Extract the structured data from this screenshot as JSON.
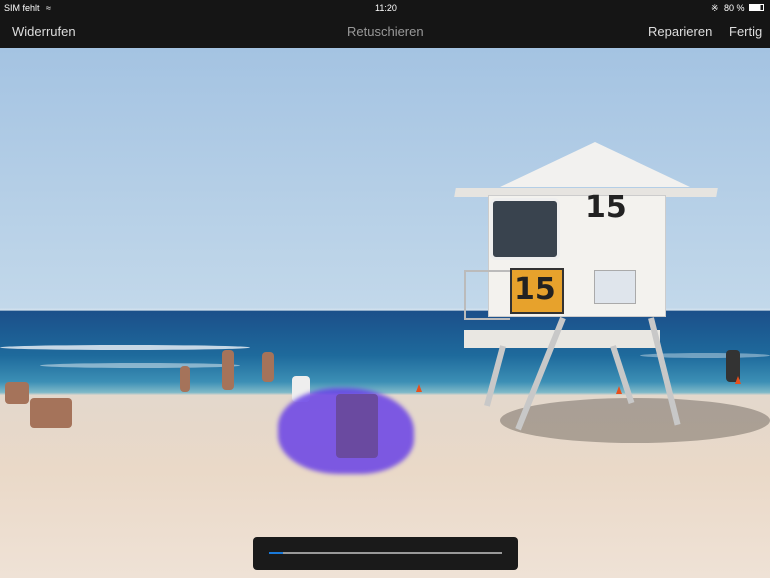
{
  "status_bar": {
    "carrier": "SIM fehlt",
    "wifi_icon": "wifi-icon",
    "time": "11:20",
    "bluetooth_icon": "bluetooth-icon",
    "battery": "80 %",
    "battery_icon": "battery-icon"
  },
  "nav": {
    "undo": "Widerrufen",
    "title": "Retuschieren",
    "repair": "Reparieren",
    "done": "Fertig"
  },
  "photo": {
    "tower_number": "15",
    "sign_number": "15",
    "selection_color": "#6a3ce6"
  },
  "slider": {
    "value_percent": 6,
    "accent": "#1a7ad9"
  }
}
